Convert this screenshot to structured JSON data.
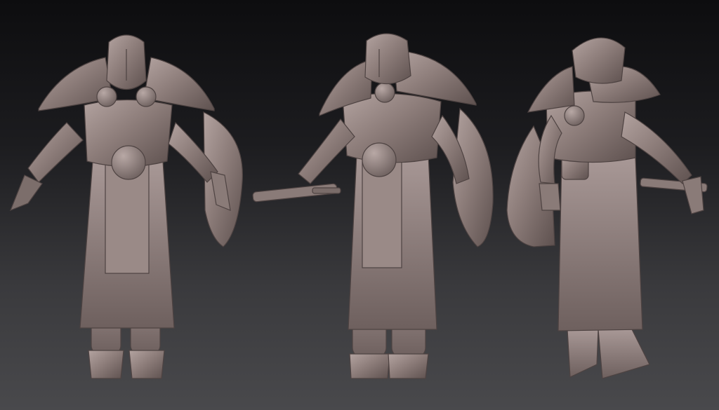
{
  "scene": {
    "background_top": "#0d0d0f",
    "background_bottom": "#49494c",
    "clay_color": "#8e7e7b",
    "clay_light": "#a89896",
    "clay_dark": "#5e514f",
    "views": [
      {
        "view": "front",
        "prop_left": "sword-hilt",
        "prop_right": "shield"
      },
      {
        "view": "three-quarter",
        "prop_left": "sword",
        "prop_right": "shield"
      },
      {
        "view": "back",
        "prop_left": "shield",
        "prop_right": "sword"
      }
    ]
  }
}
